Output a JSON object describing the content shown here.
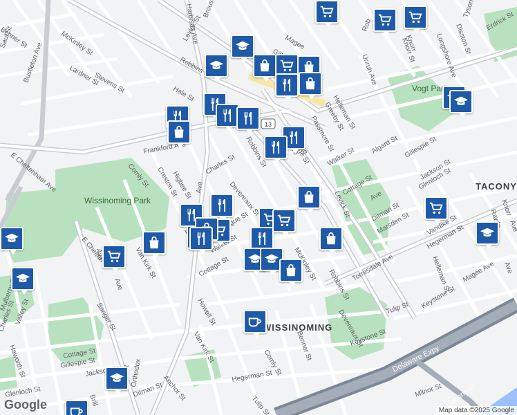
{
  "map": {
    "attribution": "Map data ©2025 Google",
    "logo": "Google",
    "colors": {
      "background": "#f2f3f5",
      "park": "#b8e2bf",
      "road": "#ffffff",
      "arterial": "#c9ccd1",
      "highway": "#7d8896",
      "marker": "#1e5aa8"
    },
    "route_badge": "13",
    "area_labels": [
      "TACONY",
      "WISSINOMING"
    ],
    "park_labels": [
      "Wissinoming Park",
      "Vogt Park"
    ],
    "highway_labels": [
      "Delaware Expy",
      "Tacony-P"
    ],
    "street_labels": [
      "Benner St",
      "Saul St",
      "McKinley St",
      "Stevens St",
      "Lardner St",
      "Bustleton Ave",
      "Harbison Ave",
      "Brous Ave",
      "Levick St",
      "Robbins St",
      "Magee",
      "Gillespie",
      "Hale St",
      "Frankford Ave",
      "E Cheltenham Ave",
      "Comly St",
      "Higbee St",
      "Creston St",
      "Charles St",
      "Devereaux St",
      "Robbins St",
      "Greeby St",
      "Passmore St",
      "Helleman St",
      "Bridge St",
      "Walker St",
      "Algard St",
      "Cottage St",
      "Gillespie St",
      "Jackson St",
      "Glenloch St",
      "Levick St",
      "Ditman St",
      "Marsden St",
      "Torresdale Ave",
      "Vandike St",
      "Hegerman St",
      "Helleman St",
      "Magee Ave",
      "Keystone St",
      "Tulip St",
      "Robbins St",
      "McKinley St",
      "Devereaux St",
      "Keystone St",
      "Benner St",
      "Comly St",
      "Hegerman St",
      "Tulip St",
      "Van Kirk St",
      "Howell St",
      "Cottage St",
      "Walker St",
      "Montague St",
      "Erdrick St",
      "Van Kirk St",
      "Sanger St",
      "Charles St",
      "Valley St",
      "Mulberry St",
      "Haworth St",
      "Cottage St",
      "Gillespie St",
      "Jackson St",
      "Glenloch St",
      "Ditman St",
      "Anchor St",
      "Milnor St",
      "Unruh Ave",
      "Knorr St",
      "Longshore Ave",
      "Disston St",
      "Tyson Ave",
      "Erdrick St",
      "Rawle",
      "Knorr",
      "Ave",
      "Ave",
      "Brill",
      "Orthodox",
      "Ave",
      "E Chelten",
      "Ave",
      "Rob",
      "Knorr",
      "Ave",
      "Ave",
      "Bridge",
      "Ave",
      "Dit",
      "Ave"
    ],
    "markers": [
      {
        "type": "grocery",
        "icon": "cart-icon"
      },
      {
        "type": "grocery",
        "icon": "cart-icon"
      },
      {
        "type": "grocery",
        "icon": "cart-icon"
      },
      {
        "type": "school",
        "icon": "graduation-cap-icon"
      },
      {
        "type": "school",
        "icon": "graduation-cap-icon"
      },
      {
        "type": "shop",
        "icon": "shopping-bag-icon"
      },
      {
        "type": "grocery",
        "icon": "cart-icon"
      },
      {
        "type": "shop",
        "icon": "shopping-bag-icon"
      },
      {
        "type": "restaurant",
        "icon": "fork-knife-icon"
      },
      {
        "type": "shop",
        "icon": "shopping-bag-icon"
      },
      {
        "type": "restaurant",
        "icon": "fork-knife-icon"
      },
      {
        "type": "restaurant",
        "icon": "fork-knife-icon"
      },
      {
        "type": "restaurant",
        "icon": "fork-knife-icon"
      },
      {
        "type": "restaurant",
        "icon": "fork-knife-icon"
      },
      {
        "type": "restaurant",
        "icon": "fork-knife-icon"
      },
      {
        "type": "shop",
        "icon": "shopping-bag-icon"
      },
      {
        "type": "restaurant",
        "icon": "fork-knife-icon"
      },
      {
        "type": "grocery",
        "icon": "cart-icon"
      },
      {
        "type": "school",
        "icon": "graduation-cap-icon"
      },
      {
        "type": "school",
        "icon": "graduation-cap-icon"
      },
      {
        "type": "shop",
        "icon": "shopping-bag-icon"
      },
      {
        "type": "restaurant",
        "icon": "fork-knife-icon"
      },
      {
        "type": "restaurant",
        "icon": "fork-knife-icon"
      },
      {
        "type": "grocery",
        "icon": "cart-icon"
      },
      {
        "type": "grocery",
        "icon": "cart-icon"
      },
      {
        "type": "grocery",
        "icon": "cart-icon"
      },
      {
        "type": "restaurant",
        "icon": "fork-knife-icon"
      },
      {
        "type": "shop",
        "icon": "shopping-bag-icon"
      },
      {
        "type": "restaurant",
        "icon": "fork-knife-icon"
      },
      {
        "type": "shop",
        "icon": "shopping-bag-icon"
      },
      {
        "type": "school",
        "icon": "graduation-cap-icon"
      },
      {
        "type": "shop",
        "icon": "shopping-bag-icon"
      },
      {
        "type": "school",
        "icon": "graduation-cap-icon"
      },
      {
        "type": "school",
        "icon": "graduation-cap-icon"
      },
      {
        "type": "grocery",
        "icon": "cart-icon"
      },
      {
        "type": "school",
        "icon": "graduation-cap-icon"
      },
      {
        "type": "school",
        "icon": "graduation-cap-icon"
      },
      {
        "type": "cafe",
        "icon": "coffee-cup-icon"
      },
      {
        "type": "school",
        "icon": "graduation-cap-icon"
      },
      {
        "type": "cafe",
        "icon": "coffee-cup-icon"
      },
      {
        "type": "shop",
        "icon": "shopping-bag-icon"
      },
      {
        "type": "restaurant",
        "icon": "fork-knife-icon"
      }
    ]
  }
}
